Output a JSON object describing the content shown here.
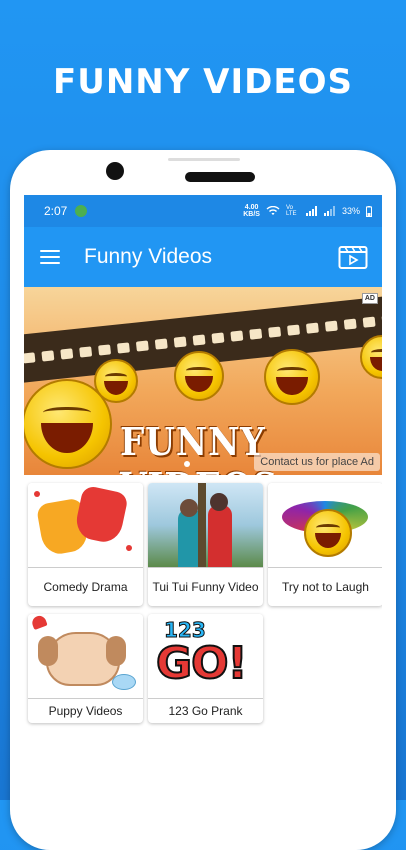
{
  "promo": {
    "title": "FUNNY VIDEOS"
  },
  "status_bar": {
    "time": "2:07",
    "net_speed_value": "4.00",
    "net_speed_unit": "KB/S",
    "lte_label": "Vo LTE",
    "battery": "33%"
  },
  "app_bar": {
    "title": "Funny Videos"
  },
  "banner": {
    "text": "FUNNY VIDEOS",
    "ad_badge": "AD",
    "ad_contact": "Contact us for place Ad"
  },
  "categories": [
    {
      "label": "Comedy Drama"
    },
    {
      "label": "Tui Tui Funny Video"
    },
    {
      "label": "Try not to Laugh"
    },
    {
      "label": "Puppy Videos"
    },
    {
      "label": "123 Go Prank"
    }
  ],
  "thumb_text": {
    "go_number": "123",
    "go_word": "GO!"
  },
  "colors": {
    "primary": "#2196F3",
    "status_bar": "#1E88E5",
    "background": "#1E88E5"
  }
}
